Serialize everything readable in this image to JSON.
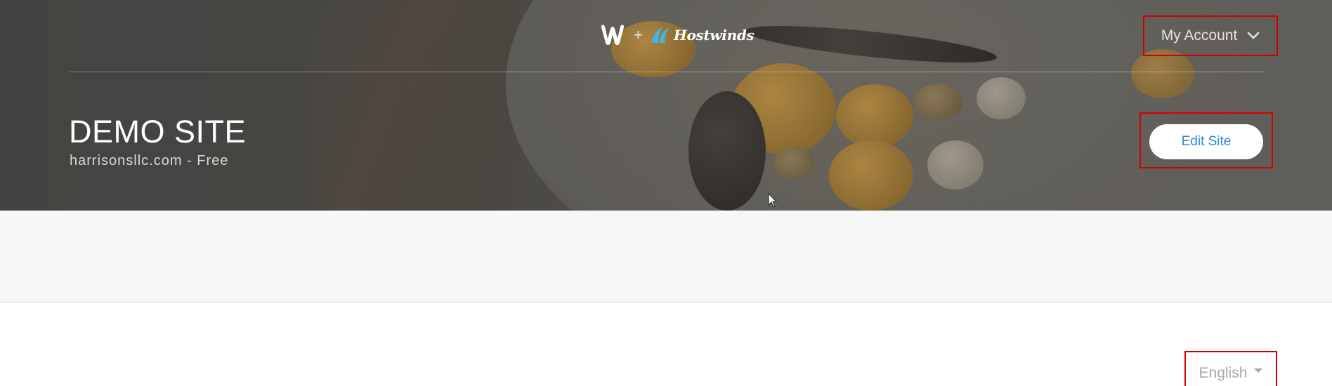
{
  "header": {
    "logo_weebly": "weebly-logo",
    "logo_plus": "+",
    "logo_partner": "Hostwinds",
    "account_label": "My Account",
    "account_icon": "chevron-down-icon"
  },
  "site": {
    "title": "DEMO SITE",
    "domain": "harrisonsllc.com",
    "separator": "-",
    "plan": "Free",
    "edit_label": "Edit Site"
  },
  "footer": {
    "language_label": "English",
    "language_icon": "caret-down-icon"
  },
  "colors": {
    "accent_blue": "#2a86d8",
    "highlight_red": "#d40000",
    "hero_overlay": "#4a4946",
    "band_gray": "#f7f7f7"
  }
}
